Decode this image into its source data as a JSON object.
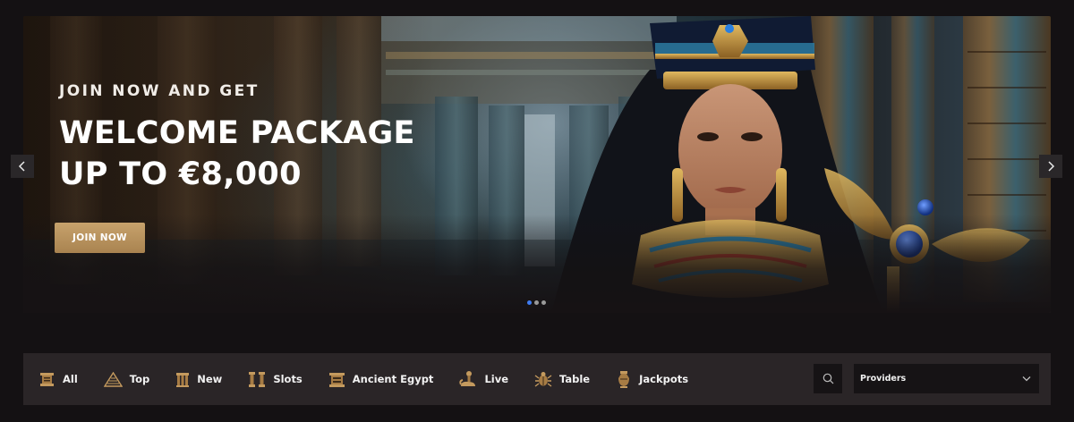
{
  "hero": {
    "kicker": "JOIN NOW AND GET",
    "title_line1": "WELCOME PACKAGE",
    "title_line2": "UP TO €8,000",
    "cta_label": "JOIN NOW",
    "slides_total": 3,
    "active_slide": 1,
    "prev_icon": "chevron-left-icon",
    "next_icon": "chevron-right-icon"
  },
  "categories": [
    {
      "label": "All",
      "icon": "scroll-icon"
    },
    {
      "label": "Top",
      "icon": "pyramid-icon"
    },
    {
      "label": "New",
      "icon": "temple-icon"
    },
    {
      "label": "Slots",
      "icon": "columns-icon"
    },
    {
      "label": "Ancient Egypt",
      "icon": "tablet-icon"
    },
    {
      "label": "Live",
      "icon": "snake-icon"
    },
    {
      "label": "Table",
      "icon": "scarab-icon"
    },
    {
      "label": "Jackpots",
      "icon": "urn-icon"
    }
  ],
  "filter": {
    "search_icon": "search-icon",
    "providers_value": "Providers",
    "providers_chevron": "chevron-down-icon"
  },
  "colors": {
    "accent_gold": "#b8925e",
    "active_dot": "#3f7cf2",
    "background": "#141113",
    "bar": "#2a2527"
  }
}
